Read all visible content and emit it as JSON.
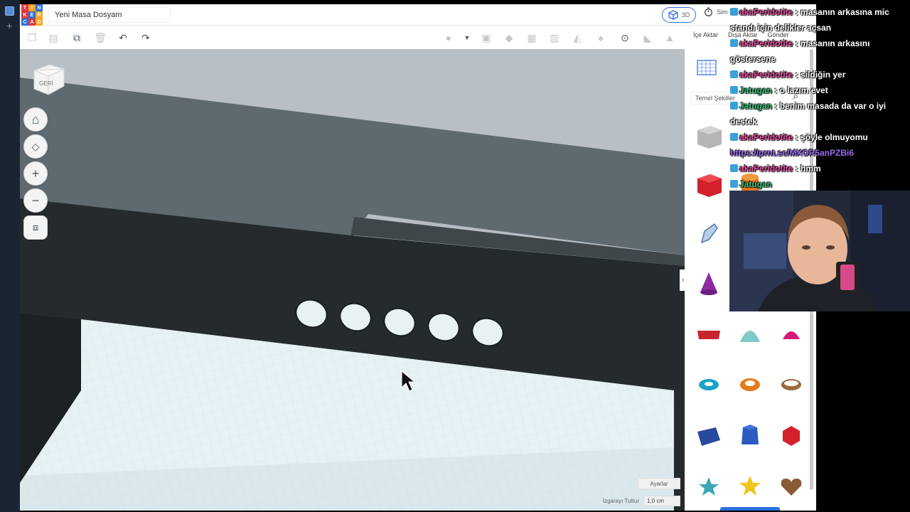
{
  "app": {
    "doc_title": "Yeni Masa Dosyam",
    "logo_letters": [
      "T",
      "I",
      "N",
      "K",
      "E",
      "R",
      "C",
      "A",
      "D"
    ],
    "logo_colors": [
      "#e0393e",
      "#f5a623",
      "#2d6fe0",
      "#e0393e",
      "#2d6fe0",
      "#f5a623",
      "#2d6fe0",
      "#e0393e",
      "#f5a623"
    ],
    "btn_3d_label": "3D",
    "btn_sim_label": "Sim Lab",
    "tabs": [
      "İçe Aktar",
      "Dışa Aktar",
      "Gönder"
    ]
  },
  "toolbar": {
    "icons": [
      "copy-icon",
      "paste-icon",
      "duplicate-icon",
      "delete-icon",
      "undo-icon",
      "redo-icon",
      "light-icon",
      "dropdown-icon",
      "group-icon",
      "ungroup-icon",
      "align-icon",
      "mirror-icon",
      "cruise-icon",
      "workplane-icon",
      "ruler-icon",
      "notes-icon"
    ]
  },
  "viewport": {
    "viewcube_label": "GERİ",
    "settings_label": "Ayarlar",
    "grid_snap_label": "Izgarayı Tuttur",
    "grid_snap_value": "1,0 cm"
  },
  "panel": {
    "category": "Temel Şekiller"
  },
  "chat": [
    {
      "user": "akaPeridotite",
      "color": "pink",
      "text": "masanın arkasına mic",
      "cont": "standı için delikler açsan"
    },
    {
      "user": "akaPeridotite",
      "color": "pink",
      "text": "masanın arkasını",
      "cont": "göstersene"
    },
    {
      "user": "akaPeridotite",
      "color": "pink",
      "text": "sildiğin yer",
      "cont": ""
    },
    {
      "user": "Jatugan",
      "color": "green",
      "text": "o lazım evet",
      "cont": ""
    },
    {
      "user": "Jatugan",
      "color": "green",
      "text": "benim masada da var o iyi",
      "cont": "destek"
    },
    {
      "user": "akaPeridotite",
      "color": "pink",
      "text": "şöyle olmuyomu",
      "cont": ""
    },
    {
      "user": "",
      "color": "link",
      "text": "https://prnt.sc/MXOR5anPZBi6",
      "cont": ""
    },
    {
      "user": "akaPeridotite",
      "color": "pink",
      "text": "hmm",
      "cont": ""
    },
    {
      "user": "Jatugan",
      "color": "green",
      "text": "",
      "cont": ""
    }
  ]
}
